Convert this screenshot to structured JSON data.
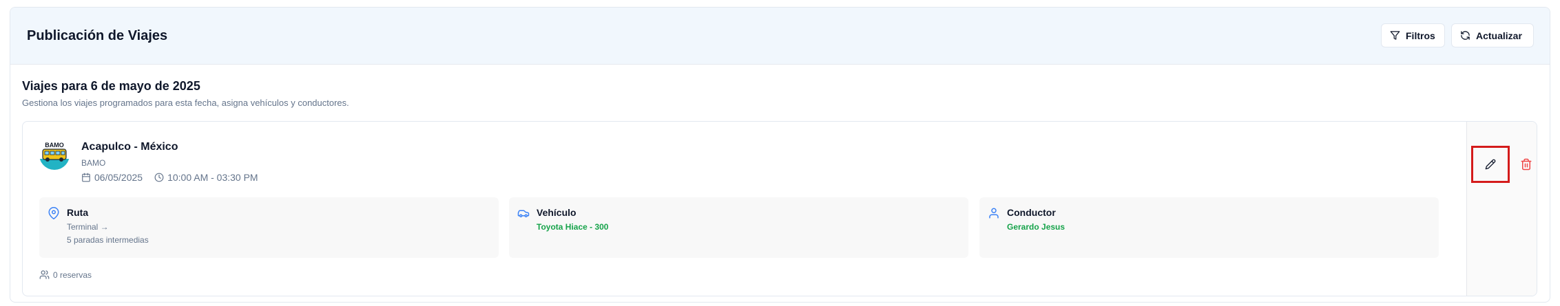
{
  "header": {
    "title": "Publicación de Viajes",
    "filters_label": "Filtros",
    "refresh_label": "Actualizar"
  },
  "section": {
    "title": "Viajes para 6 de mayo de 2025",
    "subtitle": "Gestiona los viajes programados para esta fecha, asigna vehículos y conductores."
  },
  "trip": {
    "logo_text": "BAMO",
    "name": "Acapulco - México",
    "company": "BAMO",
    "date": "06/05/2025",
    "time": "10:00 AM - 03:30 PM",
    "route": {
      "title": "Ruta",
      "line1": "Terminal →",
      "line2": "5 paradas intermedias"
    },
    "vehicle": {
      "title": "Vehículo",
      "value": "Toyota Hiace - 300"
    },
    "driver": {
      "title": "Conductor",
      "value": "Gerardo Jesus"
    },
    "reservations": "0 reservas"
  },
  "colors": {
    "header_bg": "#f1f7fd",
    "accent_blue": "#3b82f6",
    "green": "#16a34a",
    "delete_red": "#ef4444",
    "highlight_red": "#d41b1b"
  },
  "icons": [
    "filter-icon",
    "refresh-icon",
    "calendar-icon",
    "clock-icon",
    "map-pin-icon",
    "car-icon",
    "user-icon",
    "users-icon",
    "pencil-icon",
    "trash-icon"
  ]
}
